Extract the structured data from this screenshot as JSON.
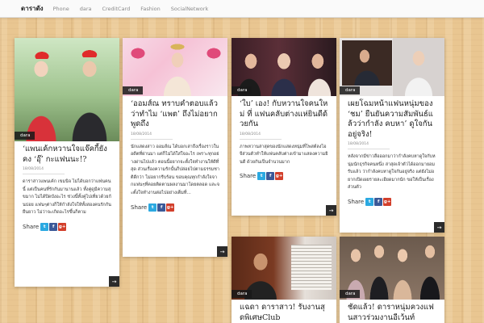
{
  "header": {
    "logo": "ดาราดัง",
    "nav": [
      "Phone",
      "dara",
      "CreditCard",
      "Fashion",
      "SocialNetwork"
    ]
  },
  "share_label": "Share",
  "icons": {
    "twitter": "t",
    "facebook": "f",
    "googleplus": "g+",
    "more": "→"
  },
  "posts": [
    {
      "category": "dara",
      "title": "‘แพนเค้กหวานใจแจ๊คกี้ยังคง ‘อุ๊’ กะแฟนนะ!?",
      "date": "18/08/2014",
      "excerpt": "ดาราสาวแพนเค้ก เขมนิจ ไม่ได้บอกว่าแฟนคนนี้ แต่เป็นคนที่รักกันมานานแล้ว ทั้งคู่ดูมีความสุขมาก ไม่ได้ปิดบังอะไร ช่วงนี้ทั้งคู่ไปเที่ยวด้วยกันบ่อย แฟนๆต่างก็ให้กำลังใจให้ทั้งสองคนรักกันยืนยาว ไม่ว่าจะเกิดอะไรขึ้นก็ตาม"
    },
    {
      "category": "dara",
      "title": "‘ออมส์ณ ทราบคำตอบแล้วว่าทำไม ‘แพต’ ถึงไม่อยากพูดถึง",
      "date": "18/08/2014",
      "excerpt": "นักแสดงสาว ออมส์ณ ได้บอกเล่าถึงเรื่องราวในอดีตที่ผ่านมา แต่ก็ไม่ได้ใส่ใจอะไร เพราะทุกอย่างผ่านไปแล้ว ตอนนี้อยากจะตั้งใจทำงานให้ดีที่สุด ส่วนเรื่องความรักนั้นก็ปล่อยไปตามธรรมชาติดีกว่า ไม่อยากรีบร้อน ขอบคุณทุกกำลังใจจากแฟนๆที่คอยติดตามผลงานมาโดยตลอด และจะตั้งใจทำงานต่อไปอย่างเต็มที่..."
    },
    {
      "category": "dara",
      "title": "‘ใบ’ เอง! กับหวานใจคนใหม่ ที่ แฟนคลับต่างแห่ยินดีด้วยกัน",
      "date": "18/08/2014",
      "excerpt": "ภาพหวานล่าสุดของนักแสดงหนุ่มที่โพสต์ลงไอจีส่วนตัวทำให้แฟนคลับต่างเข้ามาแสดงความยินดี ด้วยกันเป็นจำนวนมาก"
    },
    {
      "category": "dara",
      "title": "เผยโฉมหน้าแฟนหนุ่มของ ‘ชม’ ยืนยันความสัมพันธ์แล้วว่ากำลัง คบหา’ ดูใจกันอยู่จริง!",
      "date": "18/08/2014",
      "excerpt": "หลังจากมีข่าวลือออกมาว่ากำลังคบหาดูใจกับหนุ่มนักธุรกิจคนหนึ่ง ล่าสุดเจ้าตัวได้ออกมายอมรับแล้ว ว่ากำลังคบหาดูใจกันอยู่จริง แต่ยังไม่อยากเปิดเผยรายละเอียดมากนัก ขอให้เป็นเรื่องส่วนตัว"
    },
    {
      "category": "dara",
      "title": "แฉดา ดาราสาว! รับงานสุดพิเศษClub",
      "date": "",
      "excerpt": ""
    },
    {
      "category": "dara",
      "title": "ชัดแล้ว! ดาราหนุ่มควงแฟนสาวร่วมงานอีเว้นท์",
      "date": "",
      "excerpt": ""
    }
  ]
}
